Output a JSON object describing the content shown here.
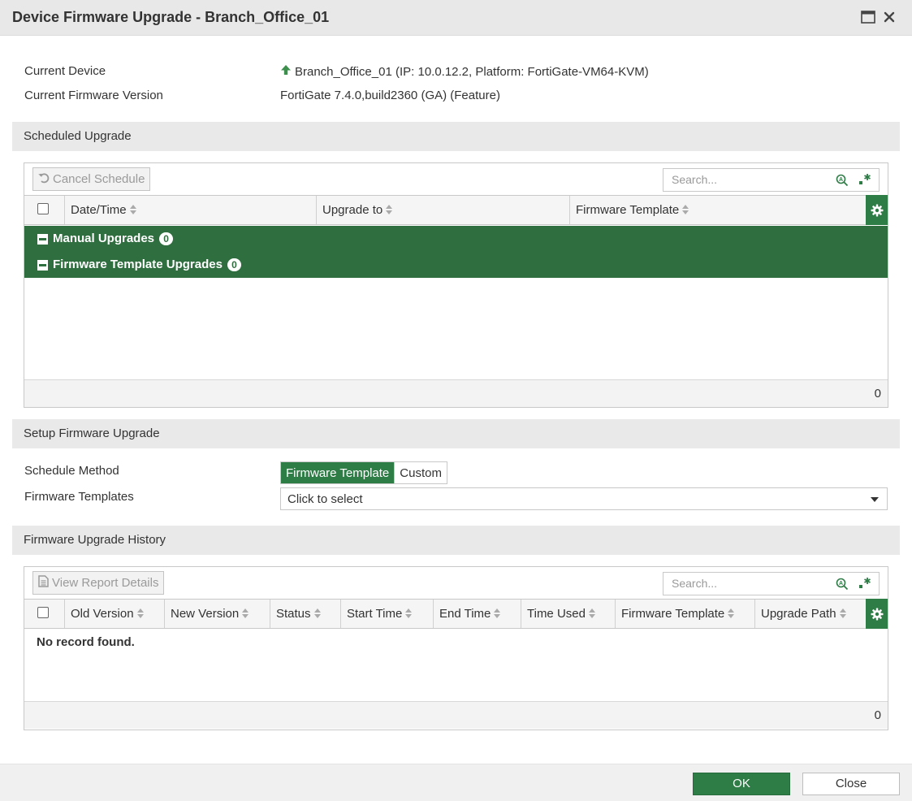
{
  "window": {
    "title": "Device Firmware Upgrade - Branch_Office_01"
  },
  "device_info": {
    "current_device_label": "Current Device",
    "current_device_value": "Branch_Office_01 (IP: 10.0.12.2, Platform: FortiGate-VM64-KVM)",
    "current_firmware_label": "Current Firmware Version",
    "current_firmware_value": "FortiGate 7.4.0,build2360 (GA) (Feature)"
  },
  "scheduled_upgrade": {
    "section_title": "Scheduled Upgrade",
    "cancel_button": "Cancel Schedule",
    "search_placeholder": "Search...",
    "columns": [
      "Date/Time",
      "Upgrade to",
      "Firmware Template"
    ],
    "groups": [
      {
        "label": "Manual Upgrades",
        "count": "0"
      },
      {
        "label": "Firmware Template Upgrades",
        "count": "0"
      }
    ],
    "total_count": "0"
  },
  "setup": {
    "section_title": "Setup Firmware Upgrade",
    "schedule_method_label": "Schedule Method",
    "schedule_options": [
      "Firmware Template",
      "Custom"
    ],
    "selected_option": "Firmware Template",
    "templates_label": "Firmware Templates",
    "templates_value": "Click to select"
  },
  "history": {
    "section_title": "Firmware Upgrade History",
    "view_report_button": "View Report Details",
    "search_placeholder": "Search...",
    "columns": [
      "Old Version",
      "New Version",
      "Status",
      "Start Time",
      "End Time",
      "Time Used",
      "Firmware Template",
      "Upgrade Path"
    ],
    "empty_message": "No record found.",
    "total_count": "0"
  },
  "footer": {
    "ok_label": "OK",
    "close_label": "Close"
  },
  "colors": {
    "accent_green": "#2e7d46",
    "group_green": "#2f6e3f"
  }
}
